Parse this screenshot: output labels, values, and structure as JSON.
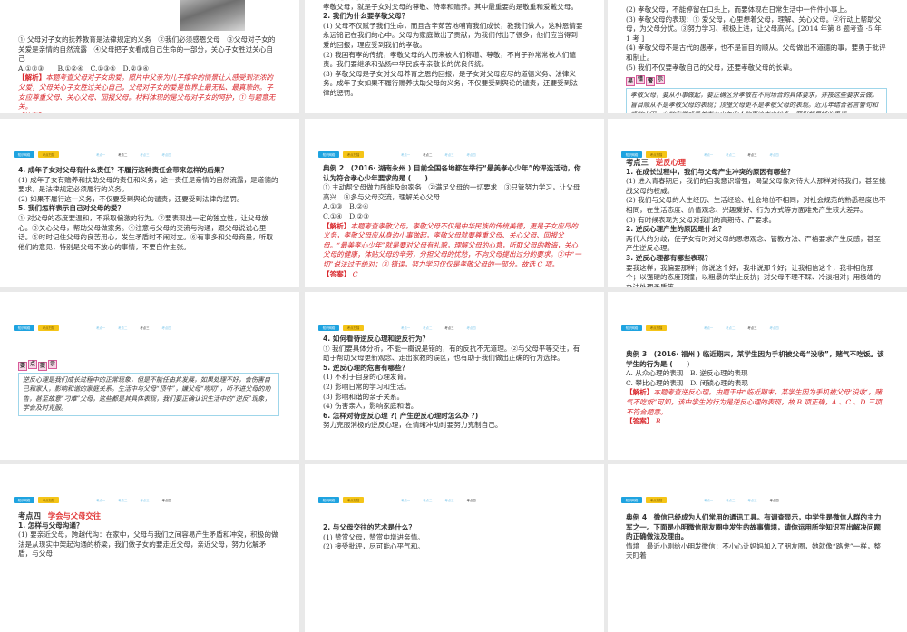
{
  "nav": {
    "btn_network": "知识网络",
    "btn_scan": "考点扫描",
    "tabs": [
      "考点一",
      "考点二",
      "考点三",
      "考点四"
    ]
  },
  "slides": [
    {
      "active_tab": 1,
      "blocks": [
        {
          "type": "img"
        },
        {
          "type": "p",
          "text": "① 父母对子女的抚养教育是法律规定的义务　②我们必须感恩父母　③父母对子女的关爱是亲情的自然流露　④父母把子女看成自己生命的一部分，关心子女胜过关心自己"
        },
        {
          "type": "p",
          "text": "A.①②③　　B.①②④　C.①③④　D.②③④"
        },
        {
          "type": "red",
          "label": "【解析】",
          "text": "本题考查父母对子女的爱。照片中父亲为儿子撑伞的情景让人感受到浓浓的父爱，父母关心子女胜过关心自己，父母对子女的爱是世界上最无私、最真挚的。子女应尊重父母、关心父母、回报父母。材料体现的是父母对子女的呵护，① 与题意无关。"
        },
        {
          "type": "answer",
          "label": "【答案】",
          "text": "D"
        }
      ]
    },
    {
      "active_tab": 1,
      "blocks": [
        {
          "type": "h",
          "text": "1. 孝敬父母的含义是什么?"
        },
        {
          "type": "p",
          "text": "孝敬父母，就是子女对父母的尊敬、侍奉和赡养。其中最重要的是敬重和爱戴父母。"
        },
        {
          "type": "h",
          "text": "2. 我们为什么要孝敬父母？"
        },
        {
          "type": "p",
          "text": "(1) 父母不仅赋予我们生命，而且含辛茹苦地哺育我们成长，教我们做人，这种恩情要永远铭记在我们的心中。父母为家庭做出了贡献，为我们付出了很多，他们应当得到爱的回报，理应受到我们的孝敬。"
        },
        {
          "type": "p",
          "text": "(2) 我国有孝的传统，孝敬父母的人历来被人们称道、尊敬，不肖子孙常常被人们谴责。我们要继承和弘扬中华民族孝亲敬长的优良传统。"
        },
        {
          "type": "p",
          "text": "(3) 孝敬父母是子女对父母养育之恩的回报，是子女对父母应尽的道德义务、法律义务。成年子女如果不履行赡养扶助父母的义务，不仅要受到舆论的谴责，还要受到法律的惩罚。"
        }
      ]
    },
    {
      "active_tab": 1,
      "blocks": [
        {
          "type": "p",
          "text": "(2) 孝敬父母，不能停留在口头上，而要体现在日常生活中一件件小事上。"
        },
        {
          "type": "p",
          "text": "(3) 孝敬父母的表现：① 爱父母，心里想着父母，理解、关心父母。②行动上帮助父母，为父母分忧。③努力学习、积极上进，让父母高兴。[2014 年第 8 题考查 ·5 年 1 考 ]"
        },
        {
          "type": "p",
          "text": "(4) 孝敬父母不是古代的愚孝，也不是盲目的顺从。父母做出不道德的事，要勇于批评和制止。"
        },
        {
          "type": "p",
          "text": "(5) 我们不仅要孝敬自己的父母，还要孝敬父母的长辈。"
        },
        {
          "type": "tip",
          "label": [
            "易",
            "错",
            "警",
            "示"
          ],
          "text": "孝敬父母，要从小事做起，要正确区分孝敬在不同场合的具体要求，并按这些要求去做。盲目顺从不是孝敬父母的表现；顶撞父母更不是孝敬父母的表现。近几年结合名言警句和感动中国、心动安徽或最美孝心少年的人物事迹考查较多，要引起足够的重视。"
        }
      ]
    },
    {
      "active_tab": 1,
      "blocks": [
        {
          "type": "h",
          "text": "4. 成年子女对父母有什么责任？不履行这种责任会带来怎样的后果？"
        },
        {
          "type": "p",
          "text": "(1) 成年子女有赡养和扶助父母的责任和义务，这一责任是亲情的自然流露，是道德的要求，是法律规定必须履行的义务。"
        },
        {
          "type": "p",
          "text": "(2) 如果不履行这一义务，不仅要受到舆论的谴责，还要受到法律的惩罚。"
        },
        {
          "type": "h",
          "text": "5. 我们怎样表示自己对父母的爱？"
        },
        {
          "type": "p",
          "text": "① 对父母的态度要温和，不采取偏激的行为。②要表现出一定的独立性，让父母放心。③关心父母，帮助父母做家务。④注意与父母的交流与沟通，跟父母说说心里话。⑤时时记住父母的良苦用心，发生矛盾时不闹对立。⑥有事多和父母商量，听取他们的意见，特别是父母不放心的事情，不要自作主张。"
        }
      ]
    },
    {
      "active_tab": 1,
      "blocks": [
        {
          "type": "h",
          "text": "典例 2　(2016· 湖南永州 ) 目前全国各地都在举行“最美孝心少年”的评选活动，你认为符合孝心少年要求的是 (　　)"
        },
        {
          "type": "p",
          "text": "① 主动帮父母做力所能及的家务　②满足父母的一切要求　③只管努力学习，让父母高兴　④多与父母交流，理解关心父母"
        },
        {
          "type": "p",
          "text": "A.①③　B.②④"
        },
        {
          "type": "p",
          "text": "C.①④　D.②③"
        },
        {
          "type": "red",
          "label": "【解析】",
          "text": "本题考查孝敬父母。孝敬父母不仅是中华民族的传统美德，更是子女应尽的义务，孝敬父母应从身边小事做起，孝敬父母就要尊重父母、关心父母、回报父母。“最美孝心少年”就是要对父母有礼貌，理解父母的心意，听取父母的教诲，关心父母的健康，体贴父母的辛劳，分担父母的忧愁，不向父母提出过分的要求。②中“一切”说法过于绝对；③ 错误，努力学习仅仅是孝敬父母的一部分。故选 C 项。"
        },
        {
          "type": "answer",
          "label": "【答案】",
          "text": "C"
        }
      ]
    },
    {
      "active_tab": 2,
      "blocks": [
        {
          "type": "kd",
          "label": "考点三",
          "text": "逆反心理"
        },
        {
          "type": "h",
          "text": "1. 在成长过程中，我们与父母产生冲突的原因有哪些？"
        },
        {
          "type": "p",
          "text": "(1) 进入青春期后，我们的自我意识增强，渴望父母像对待大人那样对待我们，甚至挑战父母的权威。"
        },
        {
          "type": "p",
          "text": "(2) 我们与父母的人生经历、生活经验、社会地位不相同，对社会规范的熟悉程度也不相同，在生活态度、价值观念、兴趣爱好、行为方式等方面难免产生较大差异。"
        },
        {
          "type": "p",
          "text": "(3) 有时候表现为父母对我们的高期待、严要求。"
        },
        {
          "type": "h",
          "text": "2. 逆反心理产生的原因是什么？"
        },
        {
          "type": "p",
          "text": "两代人的分歧，使子女有时对父母的思想观念、管教方法、严格要求产生反感，甚至产生逆反心理。"
        },
        {
          "type": "h",
          "text": "3. 逆反心理都有哪些表现？"
        },
        {
          "type": "p",
          "text": "要我这样，我偏要那样；你说这个好，我非说那个好；让我相信这个，我非相信那个；以强硬的态度顶撞，以粗暴的举止反抗；对父母不理不睬、冷淡相对；用极端的办法处理矛盾等。"
        }
      ]
    },
    {
      "active_tab": 2,
      "blocks": [
        {
          "type": "tip",
          "label": [
            "要",
            "点",
            "提",
            "示"
          ],
          "text": "逆反心理是我们成长过程中的正常现象，但是不能任由其发展，如果处理不好，会伤害自己和家人，影响和谐的家庭关系。生活中与父母“顶牛”，嫌父母“唠叨”，听不进父母的劝告，甚至故意“刁难”父母，这些都是其具体表现，我们要正确认识生活中的“逆反”现象，学会及时克服。"
        }
      ]
    },
    {
      "active_tab": 2,
      "blocks": [
        {
          "type": "h",
          "text": "4. 如何看待逆反心理和逆反行为？"
        },
        {
          "type": "p",
          "text": "① 我们要具体分析，不能一概说是错的，有的反抗不无道理。②与父母平等交往，有助于帮助父母更新观念、走出家教的误区，也有助于我们做出正确的行为选择。"
        },
        {
          "type": "h",
          "text": "5. 逆反心理的危害有哪些？"
        },
        {
          "type": "p",
          "text": "(1) 不利于自身的心理发育。"
        },
        {
          "type": "p",
          "text": "(2) 影响日常的学习和生活。"
        },
        {
          "type": "p",
          "text": "(3) 影响和谐的亲子关系。"
        },
        {
          "type": "p",
          "text": "(4) 伤害亲人，影响家庭和谐。"
        },
        {
          "type": "h",
          "text": "6. 怎样对待逆反心理 ?( 产生逆反心理时怎么办 ?)"
        },
        {
          "type": "p",
          "text": "努力克服消极的逆反心理，在情绪冲动时要努力克制自己。"
        }
      ]
    },
    {
      "active_tab": 2,
      "blocks": [
        {
          "type": "h",
          "text": "典例 3　(2016· 福州 ) 临近期末，某学生因为手机被父母“没收”，赌气不吃饭。该学生的行为是 (　　)"
        },
        {
          "type": "p",
          "text": "A. 从众心理的表现　B. 逆反心理的表现"
        },
        {
          "type": "p",
          "text": "C. 攀比心理的表现　D. 闭锁心理的表现"
        },
        {
          "type": "red",
          "label": "【解析】",
          "text": "本题考查逆反心理。由题干中“临近期末，某学生因为手机被父母‘没收’，赌气不吃饭”可知，该中学生的行为是逆反心理的表现，故 B 项正确，A 、C 、D 三项不符合题意。"
        },
        {
          "type": "answer",
          "label": "【答案】",
          "text": "B"
        }
      ]
    },
    {
      "active_tab": 3,
      "blocks": [
        {
          "type": "kd",
          "label": "考点四",
          "text": "学会与父母交往"
        },
        {
          "type": "h",
          "text": "1. 怎样与父母沟通？"
        },
        {
          "type": "p",
          "text": "(1) 要亲近父母，跨越代沟：在家中，父母与我们之间容易产生矛盾和冲突，积极的做法是从现实中架起沟通的桥梁，我们做子女的要走近父母，亲近父母，努力化解矛盾，与父母"
        }
      ]
    },
    {
      "active_tab": 3,
      "blocks": [
        {
          "type": "h",
          "text": "2. 与父母交往的艺术是什么？"
        },
        {
          "type": "p",
          "text": "(1) 赞赏父母，赞赏中增进亲情。"
        },
        {
          "type": "p",
          "text": "(2) 接受批评，尽可能心平气和。"
        }
      ]
    },
    {
      "active_tab": 3,
      "blocks": [
        {
          "type": "h",
          "text": "典例 4　微信已经成为人们常用的通讯工具。有调查显示，中学生是微信人群的主力军之一。下面是小明微信朋友圈中发生的故事情境，请你运用所学知识写出解决问题的正确做法及理由。"
        },
        {
          "type": "p",
          "text": "情境　最近小刚给小明发微信：不小心让妈妈加入了朋友圈，她就像“路虎”一样，整天盯着"
        }
      ]
    }
  ]
}
